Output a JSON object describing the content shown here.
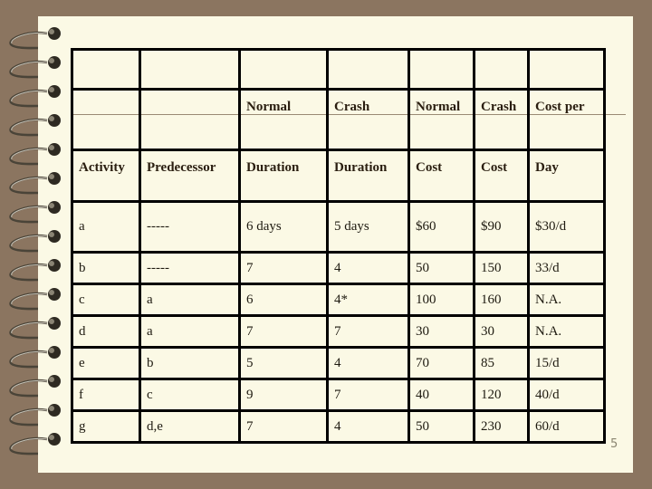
{
  "slide": {
    "page_number": "5",
    "spiral_rings": 15
  },
  "table": {
    "header_row_1": [
      "",
      "",
      "",
      "",
      "",
      "",
      ""
    ],
    "header_row_2": [
      "",
      "",
      "Normal",
      "Crash",
      "Normal",
      "Crash",
      "Cost per"
    ],
    "header_row_3": [
      "Activity",
      "Predecessor",
      "Duration",
      "Duration",
      "Cost",
      "Cost",
      "Day"
    ],
    "rows": [
      [
        "a",
        "-----",
        "6 days",
        "5 days",
        "$60",
        "$90",
        "$30/d"
      ],
      [
        "b",
        "-----",
        "7",
        "4",
        "50",
        "150",
        "33/d"
      ],
      [
        "c",
        "a",
        "6",
        "4*",
        "100",
        "160",
        "N.A."
      ],
      [
        "d",
        "a",
        "7",
        "7",
        "30",
        "30",
        "N.A."
      ],
      [
        "e",
        "b",
        "5",
        "4",
        "70",
        "85",
        "15/d"
      ],
      [
        "f",
        "c",
        "9",
        "7",
        "40",
        "120",
        "40/d"
      ],
      [
        "g",
        "d,e",
        "7",
        "4",
        "50",
        "230",
        "60/d"
      ]
    ]
  }
}
